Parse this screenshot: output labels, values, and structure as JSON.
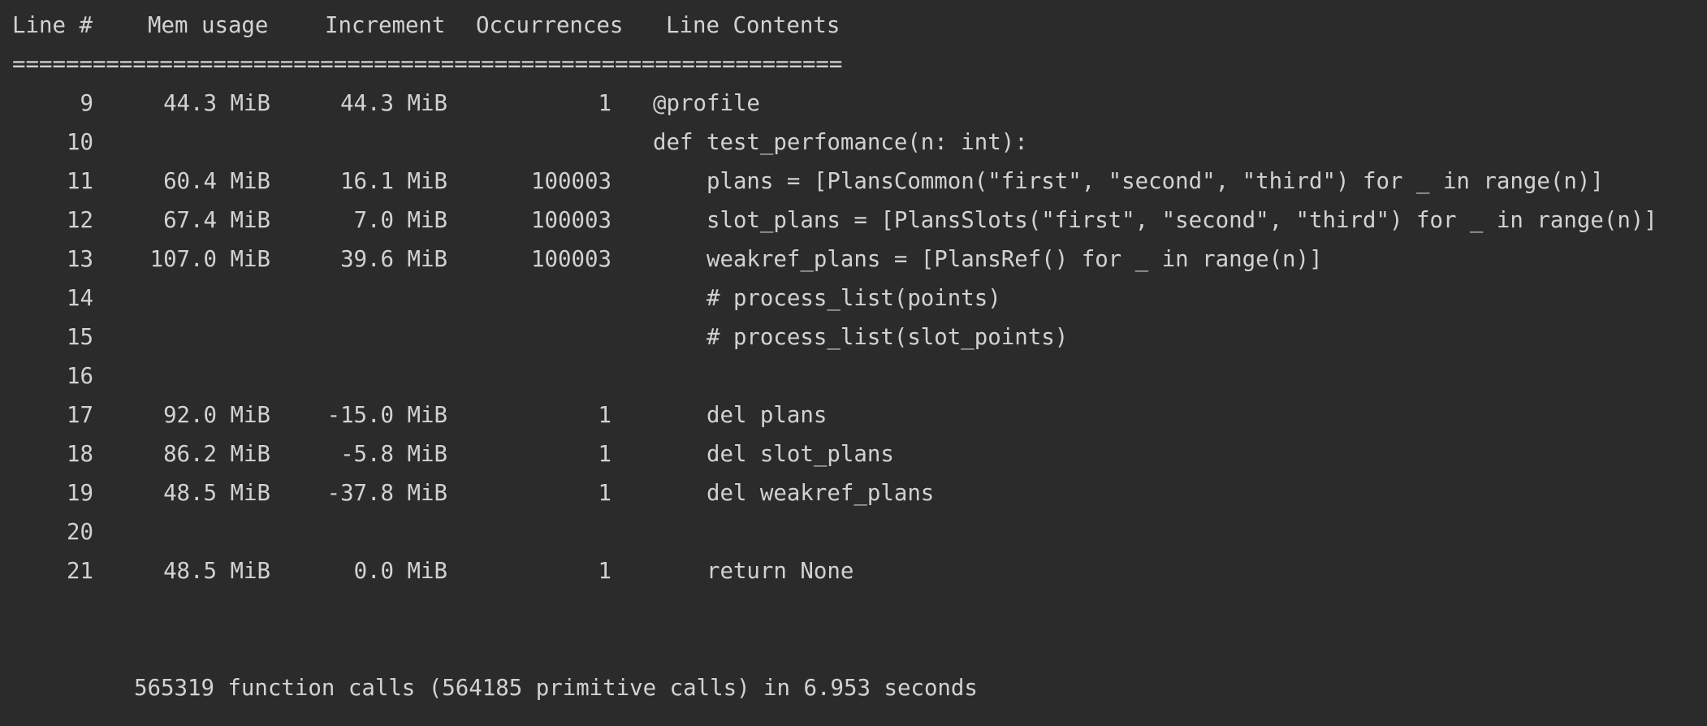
{
  "header": {
    "col_line": "Line #",
    "col_mem": "Mem usage",
    "col_increment": "Increment",
    "col_occurrences": "Occurrences",
    "col_contents": "Line Contents"
  },
  "separator": "==============================================================",
  "rows": [
    {
      "line": "9",
      "mem": "44.3 MiB",
      "inc": "44.3 MiB",
      "occ": "1",
      "code": "@profile"
    },
    {
      "line": "10",
      "mem": "",
      "inc": "",
      "occ": "",
      "code": "def test_perfomance(n: int):"
    },
    {
      "line": "11",
      "mem": "60.4 MiB",
      "inc": "16.1 MiB",
      "occ": "100003",
      "code": "    plans = [PlansCommon(\"first\", \"second\", \"third\") for _ in range(n)]"
    },
    {
      "line": "12",
      "mem": "67.4 MiB",
      "inc": "7.0 MiB",
      "occ": "100003",
      "code": "    slot_plans = [PlansSlots(\"first\", \"second\", \"third\") for _ in range(n)]"
    },
    {
      "line": "13",
      "mem": "107.0 MiB",
      "inc": "39.6 MiB",
      "occ": "100003",
      "code": "    weakref_plans = [PlansRef() for _ in range(n)]"
    },
    {
      "line": "14",
      "mem": "",
      "inc": "",
      "occ": "",
      "code": "    # process_list(points)"
    },
    {
      "line": "15",
      "mem": "",
      "inc": "",
      "occ": "",
      "code": "    # process_list(slot_points)"
    },
    {
      "line": "16",
      "mem": "",
      "inc": "",
      "occ": "",
      "code": ""
    },
    {
      "line": "17",
      "mem": "92.0 MiB",
      "inc": "-15.0 MiB",
      "occ": "1",
      "code": "    del plans"
    },
    {
      "line": "18",
      "mem": "86.2 MiB",
      "inc": "-5.8 MiB",
      "occ": "1",
      "code": "    del slot_plans"
    },
    {
      "line": "19",
      "mem": "48.5 MiB",
      "inc": "-37.8 MiB",
      "occ": "1",
      "code": "    del weakref_plans"
    },
    {
      "line": "20",
      "mem": "",
      "inc": "",
      "occ": "",
      "code": ""
    },
    {
      "line": "21",
      "mem": "48.5 MiB",
      "inc": "0.0 MiB",
      "occ": "1",
      "code": "    return None"
    }
  ],
  "summary": "565319 function calls (564185 primitive calls) in 6.953 seconds",
  "colors": {
    "background": "#2b2b2b",
    "text": "#d2d2d2"
  }
}
